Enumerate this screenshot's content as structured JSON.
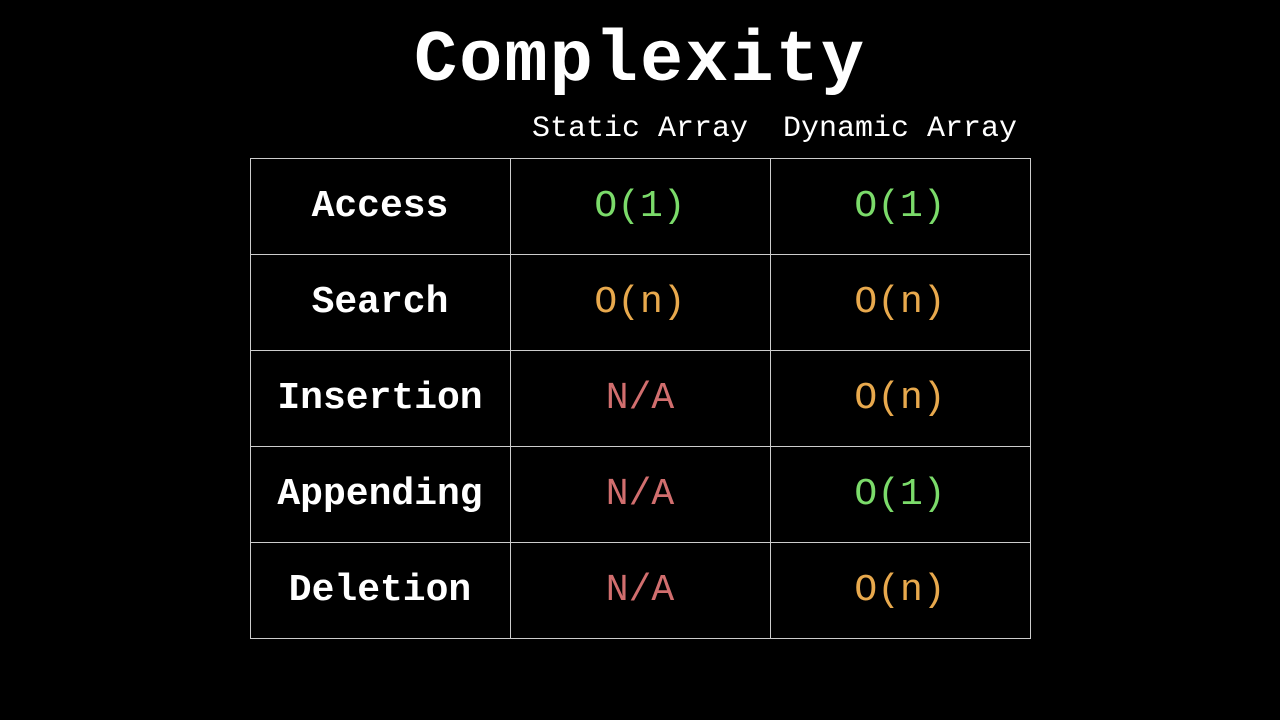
{
  "title": "Complexity",
  "columns": {
    "static": "Static Array",
    "dynamic": "Dynamic Array"
  },
  "rows": [
    {
      "label": "Access",
      "static": {
        "value": "O(1)",
        "color": "green"
      },
      "dynamic": {
        "value": "O(1)",
        "color": "green"
      }
    },
    {
      "label": "Search",
      "static": {
        "value": "O(n)",
        "color": "orange"
      },
      "dynamic": {
        "value": "O(n)",
        "color": "orange"
      }
    },
    {
      "label": "Insertion",
      "static": {
        "value": "N/A",
        "color": "red"
      },
      "dynamic": {
        "value": "O(n)",
        "color": "orange"
      }
    },
    {
      "label": "Appending",
      "static": {
        "value": "N/A",
        "color": "red"
      },
      "dynamic": {
        "value": "O(1)",
        "color": "green"
      }
    },
    {
      "label": "Deletion",
      "static": {
        "value": "N/A",
        "color": "red"
      },
      "dynamic": {
        "value": "O(n)",
        "color": "orange"
      }
    }
  ],
  "chart_data": {
    "type": "table",
    "title": "Complexity",
    "columns": [
      "",
      "Static Array",
      "Dynamic Array"
    ],
    "rows": [
      [
        "Access",
        "O(1)",
        "O(1)"
      ],
      [
        "Search",
        "O(n)",
        "O(n)"
      ],
      [
        "Insertion",
        "N/A",
        "O(n)"
      ],
      [
        "Appending",
        "N/A",
        "O(1)"
      ],
      [
        "Deletion",
        "N/A",
        "O(n)"
      ]
    ]
  }
}
